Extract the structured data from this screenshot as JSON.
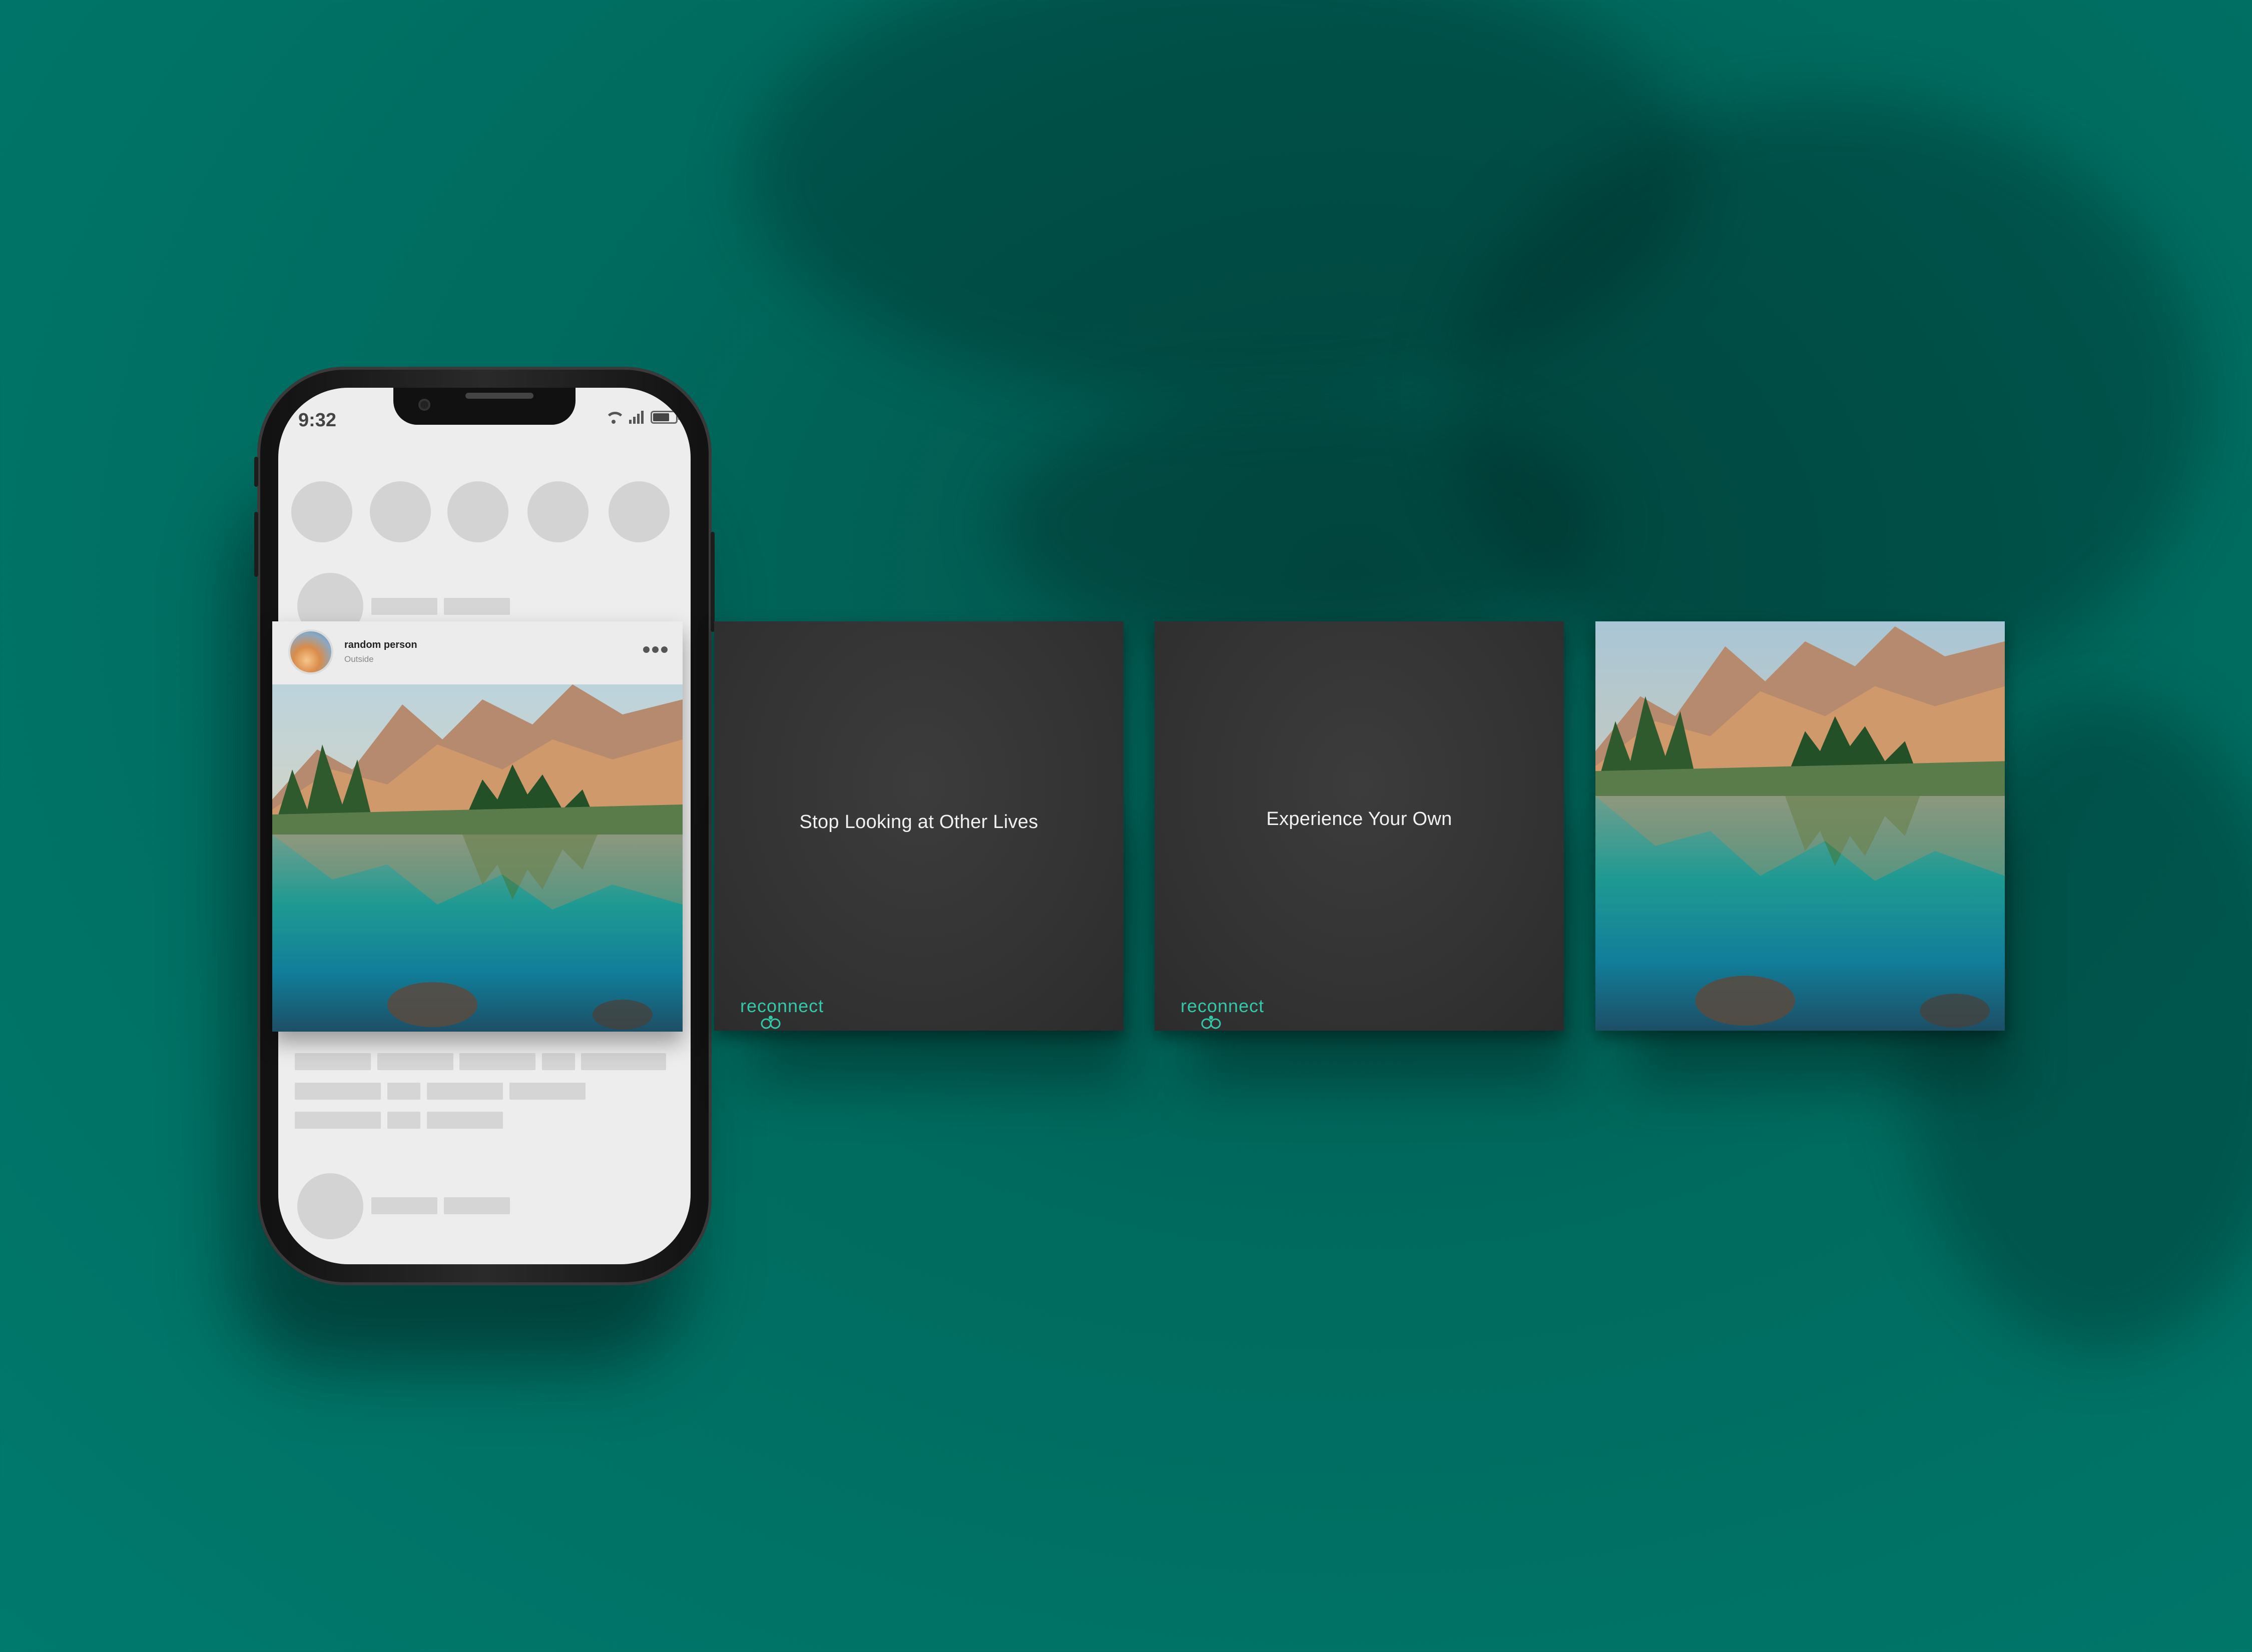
{
  "phone": {
    "status_time": "9:32",
    "post": {
      "username": "random person",
      "location": "Outside"
    }
  },
  "slides": [
    {
      "text": "Stop Looking at Other Lives",
      "brand": "reconnect"
    },
    {
      "text": "Experience Your Own",
      "brand": "reconnect"
    }
  ],
  "icons": {
    "status": [
      "wifi-icon",
      "signal-icon",
      "battery-icon"
    ],
    "post_menu": "more-icon",
    "brand_mark": "linked-circles-icon"
  },
  "colors": {
    "background": "#007a6d",
    "slide": "#333333",
    "brand_accent": "#35c7a9",
    "screen": "#ededed"
  }
}
